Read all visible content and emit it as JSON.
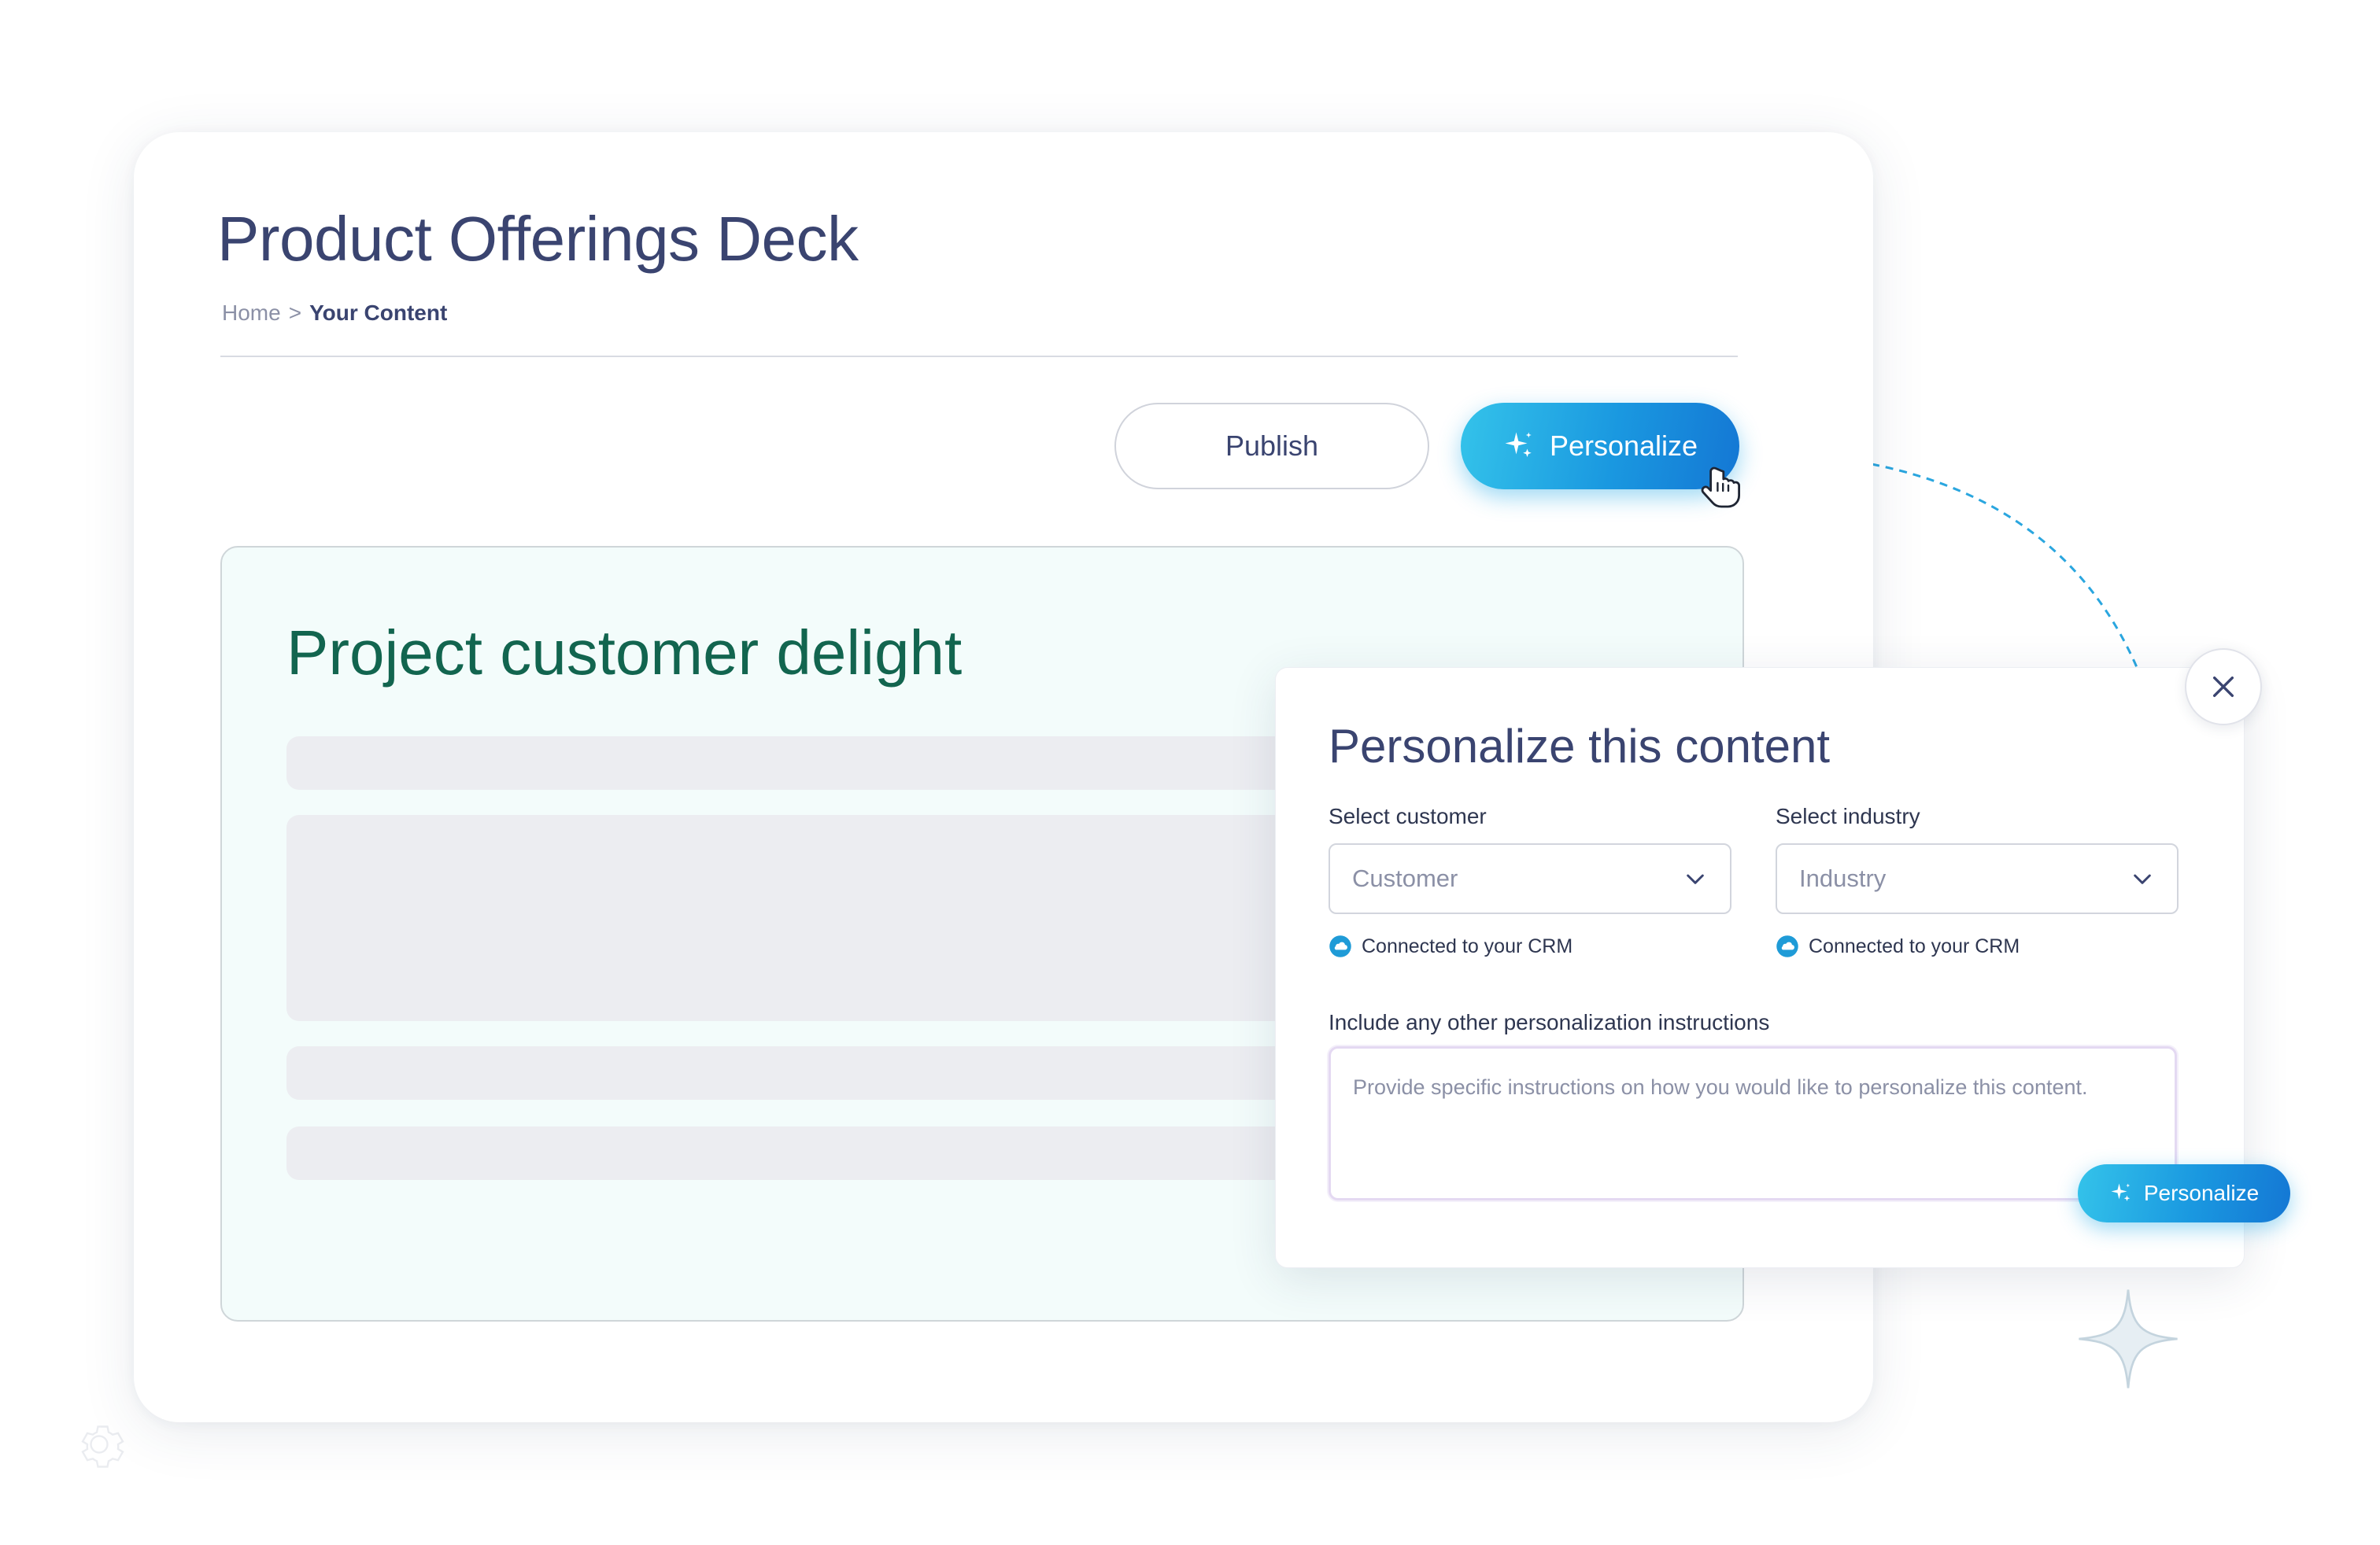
{
  "page": {
    "title": "Product Offerings Deck",
    "breadcrumb": {
      "home": "Home",
      "separator": ">",
      "current": "Your Content"
    }
  },
  "toolbar": {
    "publish_label": "Publish",
    "personalize_label": "Personalize"
  },
  "slide": {
    "title": "Project customer delight"
  },
  "modal": {
    "title": "Personalize this content",
    "customer": {
      "label": "Select customer",
      "placeholder": "Customer",
      "crm_note": "Connected to your CRM"
    },
    "industry": {
      "label": "Select industry",
      "placeholder": "Industry",
      "crm_note": "Connected to your CRM"
    },
    "instructions": {
      "label": "Include any other personalization instructions",
      "placeholder": "Provide specific instructions on how you would like to personalize this content."
    },
    "submit_label": "Personalize"
  },
  "colors": {
    "title_navy": "#3a4470",
    "slide_title_green": "#12654f",
    "accent_blue": "#1a98e0",
    "slide_bg": "#f3fcfb"
  },
  "icons": [
    "sparkle-icon",
    "pointer-hand-icon",
    "close-icon",
    "chevron-down-icon",
    "cloud-icon",
    "star-icon",
    "gear-icon"
  ]
}
